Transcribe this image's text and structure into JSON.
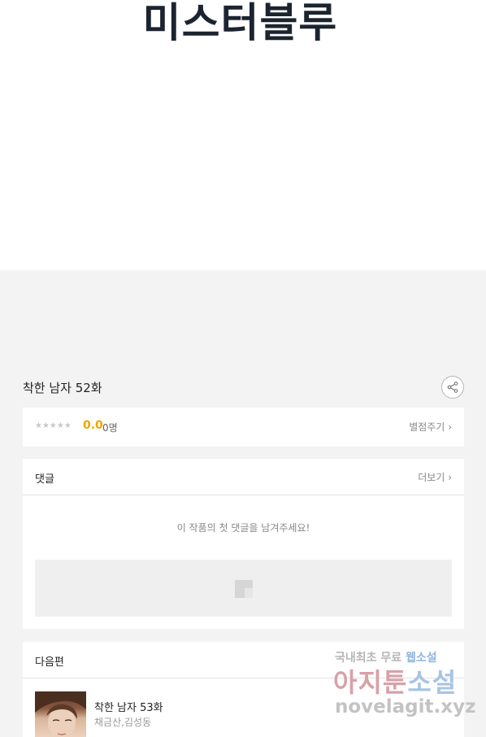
{
  "comic": {
    "title_art": "미스터블루"
  },
  "episode": {
    "title": "착한 남자 52화"
  },
  "rating": {
    "stars": "★★★★★",
    "score": "0.0",
    "count": "0명",
    "rate_link": "별점주기"
  },
  "comments": {
    "title": "댓글",
    "more_link": "더보기",
    "empty_message": "이 작품의 첫 댓글을 남겨주세요!"
  },
  "next_episode": {
    "section_title": "다음편",
    "title": "착한 남자 53화",
    "authors": "채금산,김성동"
  },
  "watermark": {
    "line1_a": "국내최초 무료",
    "line1_b": "웹소설",
    "line2_a": "아지툰",
    "line2_b": "소설",
    "line3": "novelagit.xyz"
  },
  "colors": {
    "score": "#f0a500",
    "title_ink": "#1c2430",
    "background": "#f3f3f3"
  }
}
